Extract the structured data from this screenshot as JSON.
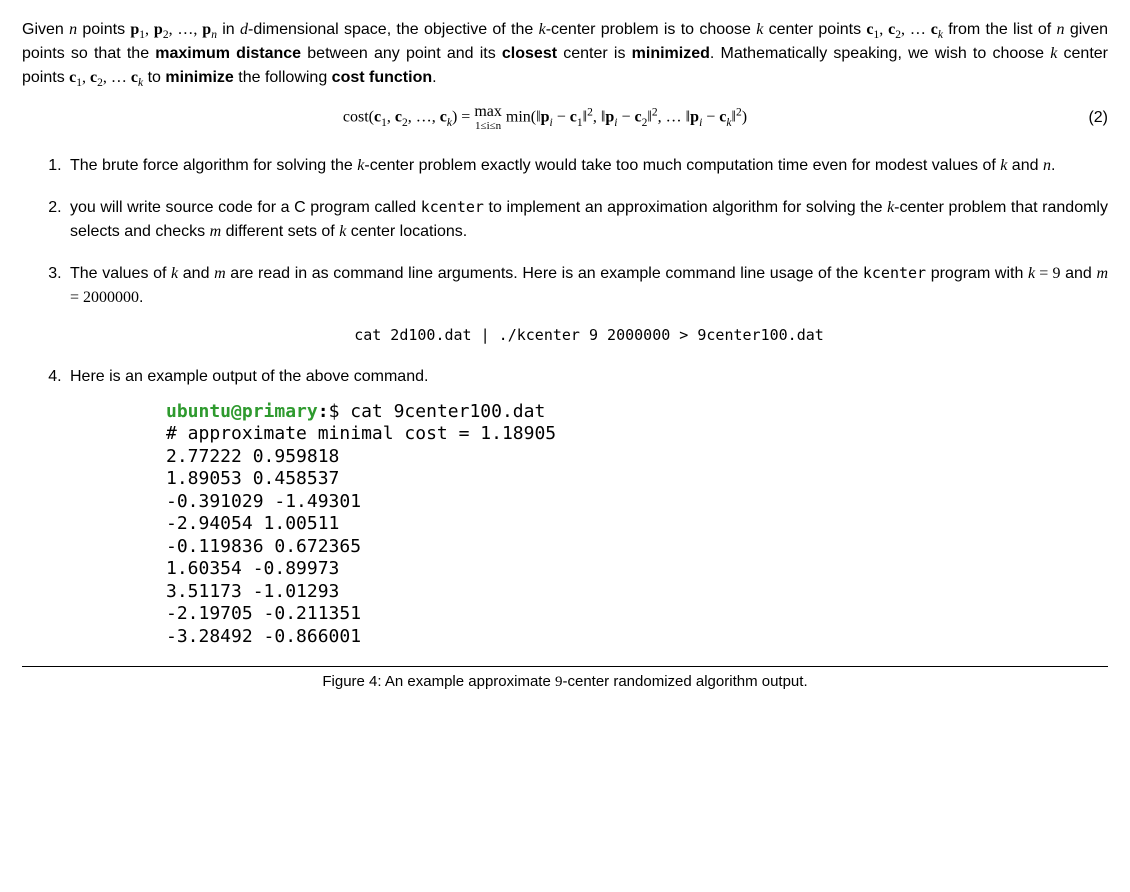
{
  "intro": {
    "t1": "Given ",
    "n": "n",
    "t2": " points ",
    "pts": "p",
    "t3": " in ",
    "d": "d",
    "t4": "-dimensional space, the objective of the ",
    "k": "k",
    "t5": "-center problem is to choose ",
    "t6": " center points ",
    "cs": "c",
    "t7": " from the list of ",
    "t8": " given points so that the ",
    "b1": "maximum distance",
    "t9": " between any point and its ",
    "b2": "closest",
    "t10": " center is ",
    "b3": "minimized",
    "t11": ". Mathematically speaking, we wish to choose ",
    "t12": " center points ",
    "t13": " to ",
    "b4": "minimize",
    "t14": " the following ",
    "b5": "cost function",
    "t15": "."
  },
  "eq": {
    "cost": "cost",
    "lhs_c": "c",
    "eq": " = ",
    "max": "max",
    "maxsub": "1≤i≤n",
    "min": "min",
    "p": "p",
    "isub": "i",
    "num": "(2)"
  },
  "items": {
    "i1a": "The brute force algorithm for solving the ",
    "i1b": "-center problem exactly would take too much computation time even for modest values of ",
    "and": " and ",
    "period": ".",
    "i2a": "you will write source code for a C program called ",
    "prog": "kcenter",
    "i2b": " to implement an approximation algorithm for solving the ",
    "i2c": "-center problem that randomly selects and checks ",
    "m": "m",
    "i2d": " different sets of ",
    "i2e": " center locations.",
    "i3a": "The values of ",
    "i3b": " are read in as command line arguments. Here is an example command line usage of the ",
    "i3c": " program with ",
    "keq": "k = 9",
    "meq": "m = 2000000",
    "cmd": "cat 2d100.dat | ./kcenter 9 2000000 > 9center100.dat",
    "i4": "Here is an example output of the above command."
  },
  "term": {
    "user": "ubuntu@primary",
    "colon": ":",
    "dollar": "$ ",
    "catcmd": "cat 9center100.dat",
    "lines": [
      "# approximate minimal cost = 1.18905",
      "2.77222 0.959818",
      "1.89053 0.458537",
      "-0.391029 -1.49301",
      "-2.94054 1.00511",
      "-0.119836 0.672365",
      "1.60354 -0.89973",
      "3.51173 -1.01293",
      "-2.19705 -0.211351",
      "-3.28492 -0.866001"
    ]
  },
  "figcap": {
    "pre": "Figure 4: An example approximate ",
    "nine": "9",
    "post": "-center randomized algorithm output."
  }
}
